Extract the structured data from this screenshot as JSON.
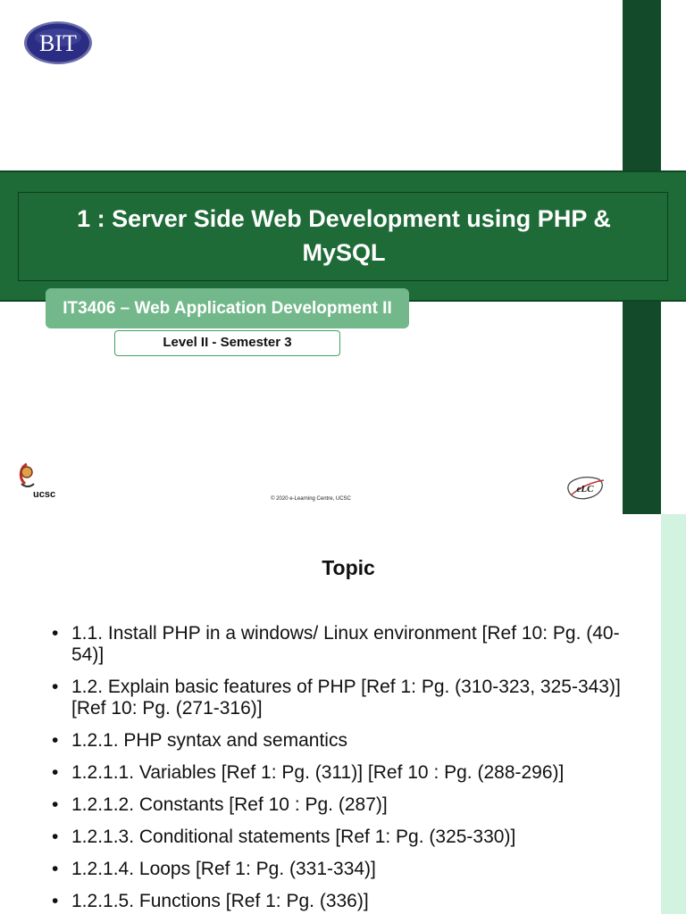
{
  "slide1": {
    "logo_text": "BIT",
    "title": "1 : Server Side Web Development using PHP & MySQL",
    "course": "IT3406 – Web Application Development II",
    "level": "Level II - Semester 3",
    "ucsc_logo_text": "ucsc",
    "copyright": "© 2020 e-Learning Centre, UCSC",
    "elc_logo_text": "eLC",
    "colors": {
      "dark_green": "#134b2a",
      "band_green": "#1e6b38",
      "pill_green": "#72b88a",
      "logo_navy": "#2a2d83"
    }
  },
  "slide2": {
    "heading": "Topic",
    "bullet": "•",
    "items": [
      "1.1. Install PHP in a windows/ Linux environment [Ref 10: Pg. (40-54)]",
      "1.2. Explain basic features of PHP [Ref 1: Pg. (310-323, 325-343)] [Ref 10: Pg. (271-316)]",
      "1.2.1. PHP syntax and semantics",
      "1.2.1.1. Variables [Ref 1: Pg. (311)] [Ref 10 : Pg. (288-296)]",
      "1.2.1.2. Constants [Ref 10 : Pg. (287)]",
      "1.2.1.3. Conditional statements [Ref 1: Pg. (325-330)]",
      "1.2.1.4. Loops [Ref 1: Pg. (331-334)]",
      "1.2.1.5. Functions [Ref 1: Pg. (336)]"
    ],
    "colors": {
      "mint": "#d3f3e1"
    }
  }
}
